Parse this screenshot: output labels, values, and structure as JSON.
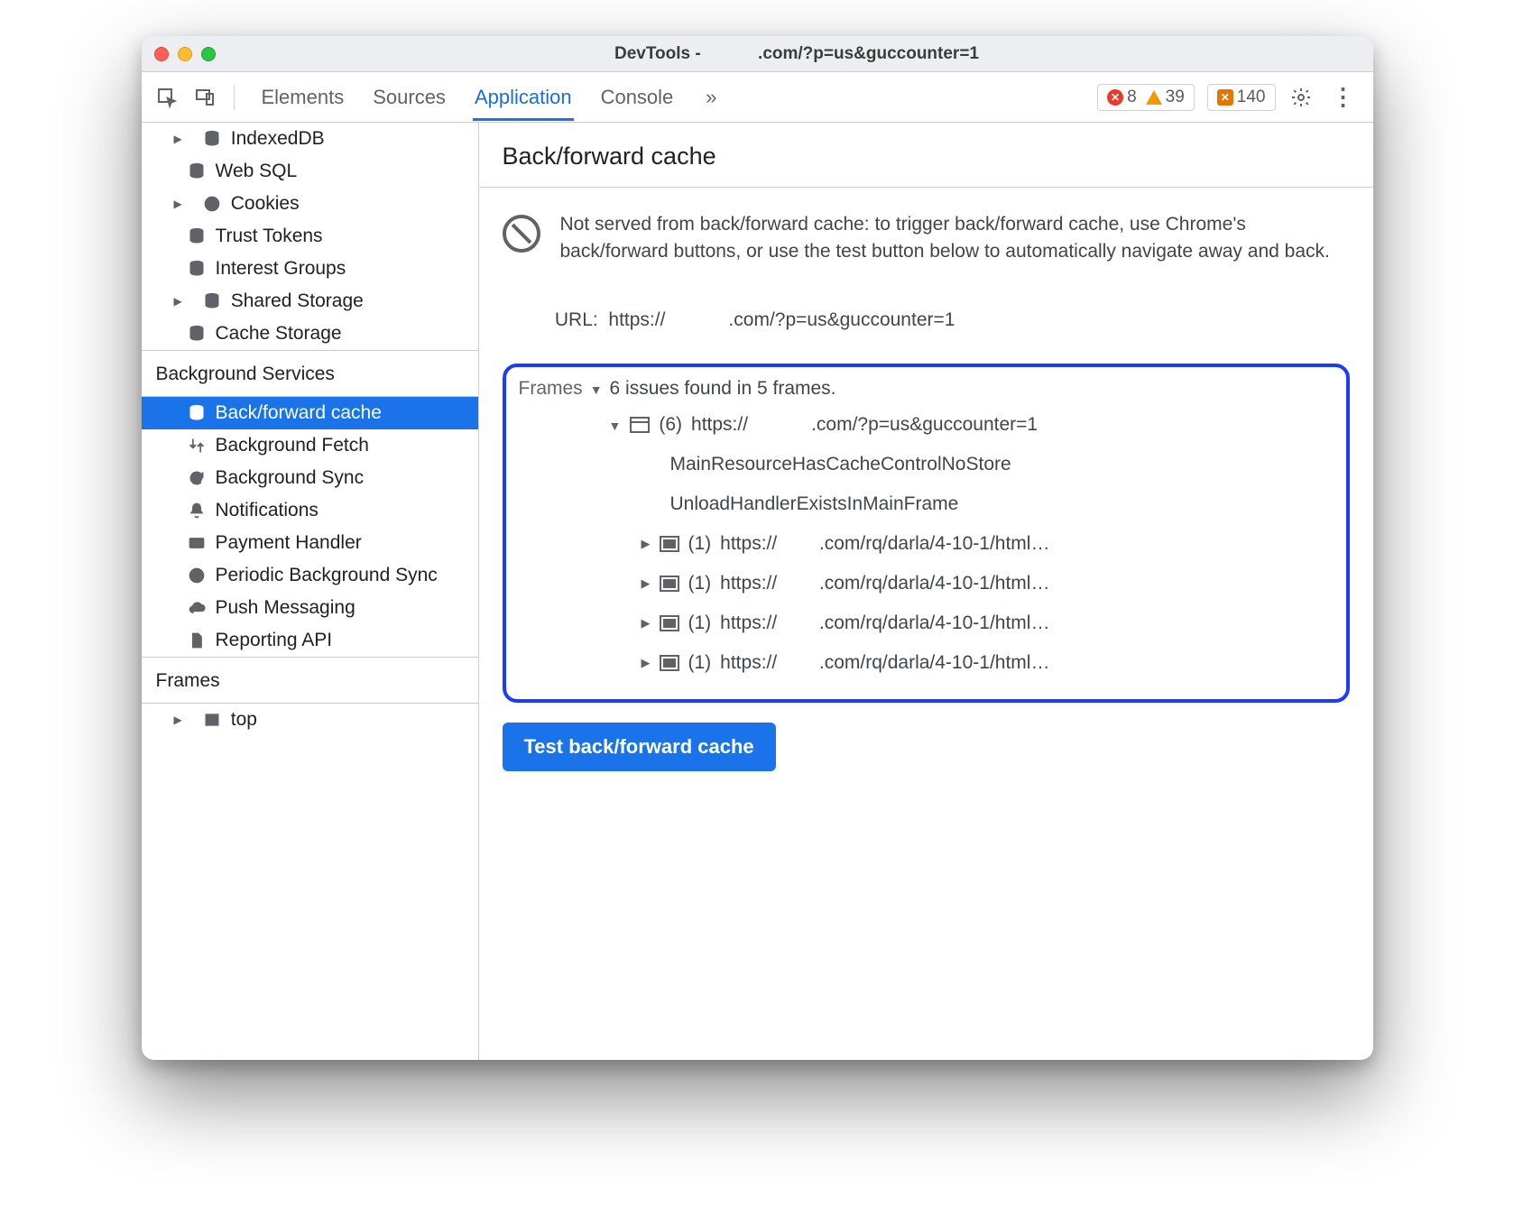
{
  "title": "DevTools -            .com/?p=us&guccounter=1",
  "tabs": [
    "Elements",
    "Sources",
    "Application",
    "Console"
  ],
  "active_tab": "Application",
  "counters": {
    "errors": 8,
    "warnings": 39,
    "messages": 140
  },
  "sidebar": {
    "storage_items": [
      {
        "label": "IndexedDB",
        "icon": "database",
        "expandable": true
      },
      {
        "label": "Web SQL",
        "icon": "database",
        "expandable": false
      },
      {
        "label": "Cookies",
        "icon": "cookie",
        "expandable": true
      },
      {
        "label": "Trust Tokens",
        "icon": "database",
        "expandable": false
      },
      {
        "label": "Interest Groups",
        "icon": "database",
        "expandable": false
      },
      {
        "label": "Shared Storage",
        "icon": "database",
        "expandable": true
      },
      {
        "label": "Cache Storage",
        "icon": "database",
        "expandable": false
      }
    ],
    "bg_title": "Background Services",
    "bg_items": [
      {
        "label": "Back/forward cache",
        "icon": "database",
        "selected": true
      },
      {
        "label": "Background Fetch",
        "icon": "transfer"
      },
      {
        "label": "Background Sync",
        "icon": "sync"
      },
      {
        "label": "Notifications",
        "icon": "bell"
      },
      {
        "label": "Payment Handler",
        "icon": "card"
      },
      {
        "label": "Periodic Background Sync",
        "icon": "clock",
        "truncated": true
      },
      {
        "label": "Push Messaging",
        "icon": "cloud"
      },
      {
        "label": "Reporting API",
        "icon": "file"
      }
    ],
    "frames_title": "Frames",
    "frames_items": [
      {
        "label": "top",
        "icon": "frame",
        "expandable": true
      }
    ]
  },
  "main": {
    "header": "Back/forward cache",
    "info": "Not served from back/forward cache: to trigger back/forward cache, use Chrome's back/forward buttons, or use the test button below to automatically navigate away and back.",
    "url_label": "URL:",
    "url_value": "https://            .com/?p=us&guccounter=1",
    "frames_label": "Frames",
    "frames_summary": "6 issues found in 5 frames.",
    "top_frame": {
      "count": "(6)",
      "url": "https://            .com/?p=us&guccounter=1",
      "reasons": [
        "MainResourceHasCacheControlNoStore",
        "UnloadHandlerExistsInMainFrame"
      ],
      "subframes": [
        {
          "count": "(1)",
          "url": "https://        .com/rq/darla/4-10-1/html…"
        },
        {
          "count": "(1)",
          "url": "https://        .com/rq/darla/4-10-1/html…"
        },
        {
          "count": "(1)",
          "url": "https://        .com/rq/darla/4-10-1/html…"
        },
        {
          "count": "(1)",
          "url": "https://        .com/rq/darla/4-10-1/html…"
        }
      ]
    },
    "test_button": "Test back/forward cache"
  }
}
